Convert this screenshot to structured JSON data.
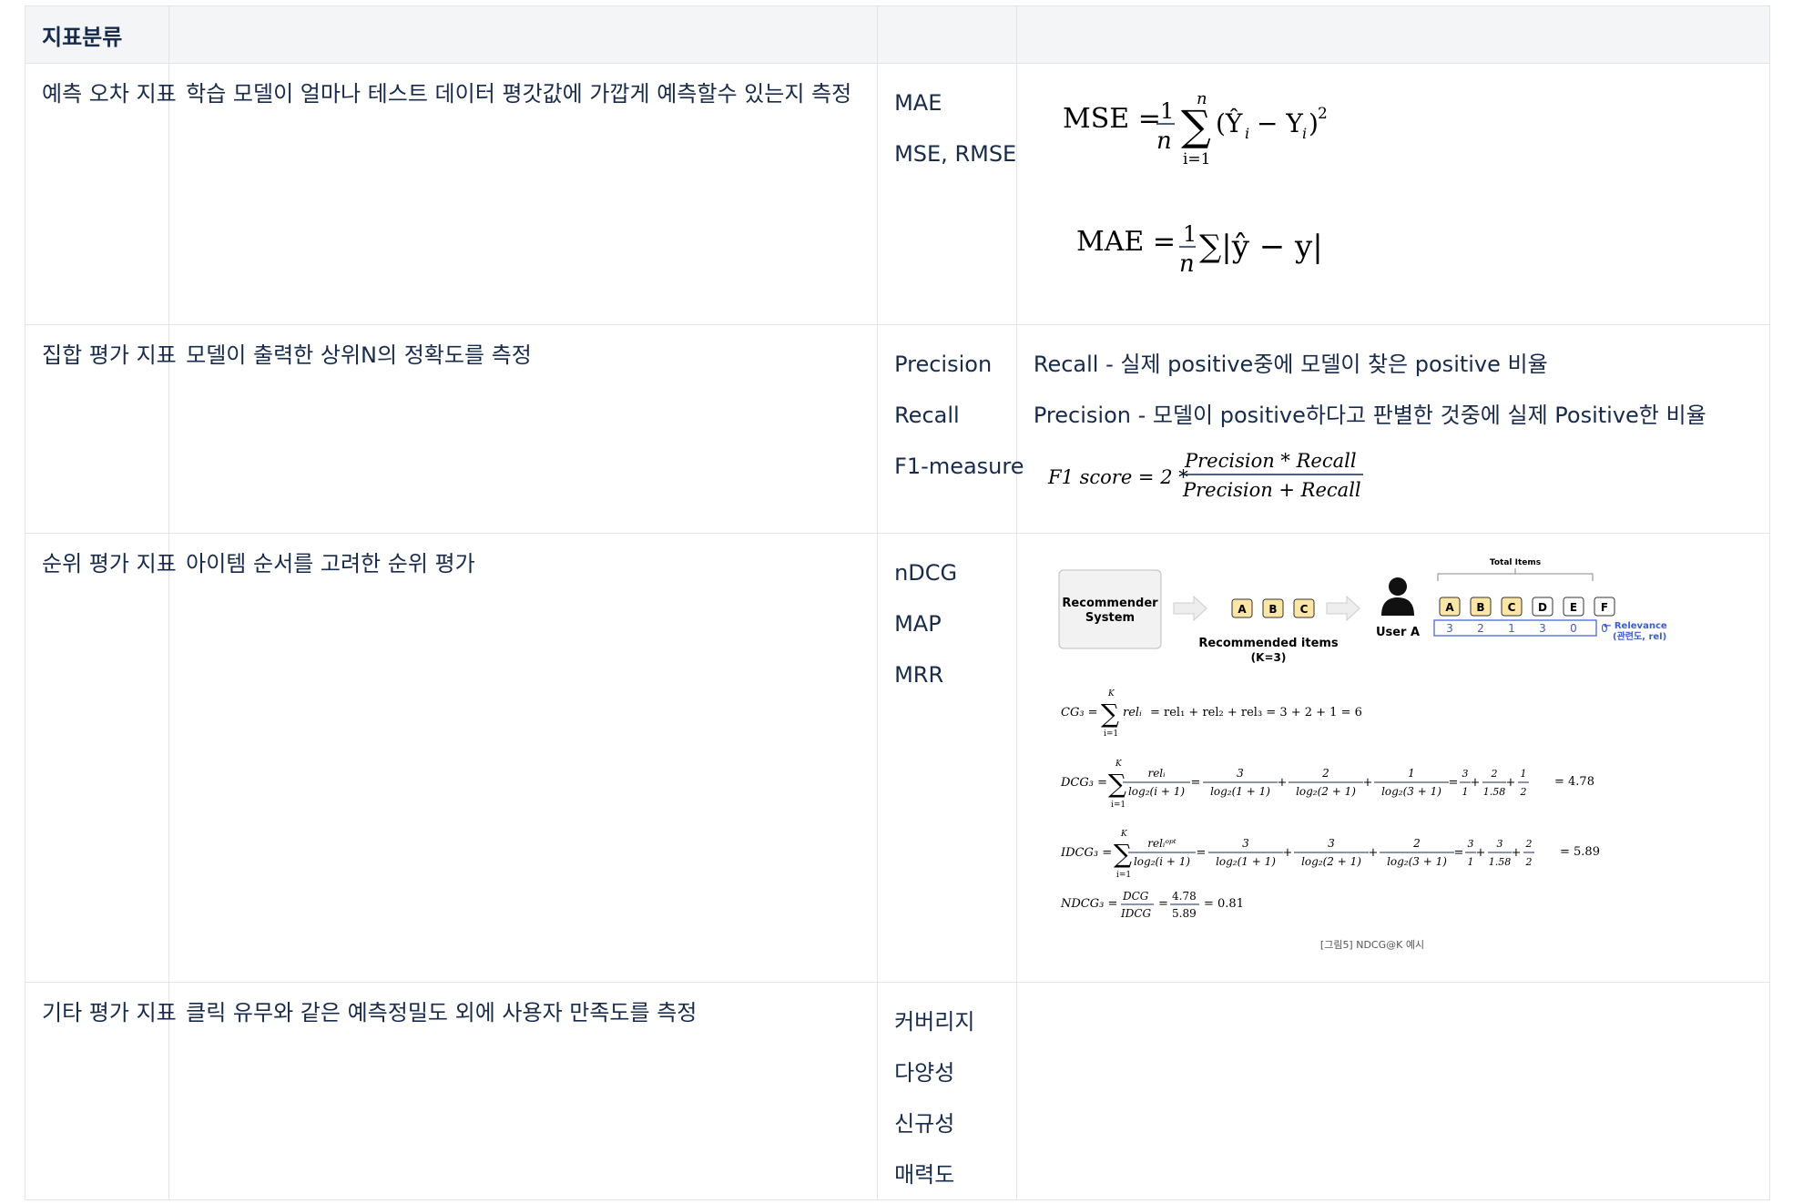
{
  "header": {
    "col1": "지표분류",
    "col2": "",
    "col3": "",
    "col4": ""
  },
  "rows": [
    {
      "category": "예측 오차 지표",
      "description": "학습 모델이 얼마나 테스트 데이터 평갓값에 가깝게 예측할수 있는지 측정",
      "metrics": [
        "MAE",
        "MSE, RMSE"
      ]
    },
    {
      "category": "집합 평가 지표",
      "description": "모델이 출력한 상위N의 정확도를 측정",
      "metrics": [
        "Precision",
        "Recall",
        "F1-measure"
      ],
      "notes": [
        "Recall - 실제 positive중에 모델이 찾은 positive 비율",
        "Precision - 모델이 positive하다고 판별한 것중에 실제 Positive한 비율"
      ]
    },
    {
      "category": "순위 평가 지표",
      "description": "아이템 순서를 고려한 순위 평가",
      "metrics": [
        "nDCG",
        "MAP",
        "MRR"
      ]
    },
    {
      "category": "기타 평가 지표",
      "description": "클릭 유무와 같은 예측정밀도 외에 사용자 만족도를 측정",
      "metrics": [
        "커버리지",
        "다양성",
        "신규성",
        "매력도"
      ]
    }
  ],
  "formulas": {
    "mse_lhs": "MSE =",
    "mae_lhs": "MAE =",
    "f1_lhs": "F1 score = 2 *",
    "f1_num": "Precision  * Recall",
    "f1_den": "Precision + Recall"
  },
  "ndcg_figure": {
    "recommender_label_1": "Recommender",
    "recommender_label_2": "System",
    "recommended_items": [
      "A",
      "B",
      "C"
    ],
    "recommended_caption_1": "Recommended items",
    "recommended_caption_2": "(K=3)",
    "user_label": "User A",
    "total_items_label": "Total Items",
    "all_items": [
      "A",
      "B",
      "C",
      "D",
      "E",
      "F"
    ],
    "relevance": [
      "3",
      "2",
      "1",
      "3",
      "0",
      "0"
    ],
    "relevance_label_1": "← Relevance",
    "relevance_label_2": "(관련도, rel)",
    "cg_result": "= rel₁ + rel₂ + rel₃ = 3 + 2 + 1 = 6",
    "dcg_result": "= 4.78",
    "idcg_result": "= 5.89",
    "ndcg_vals": [
      "4.78",
      "5.89"
    ],
    "ndcg_result": "= 0.81",
    "caption": "[그림5] NDCG@K 예시",
    "highlight_color": "#fce6a4",
    "relevance_color": "#3b5bdb"
  }
}
